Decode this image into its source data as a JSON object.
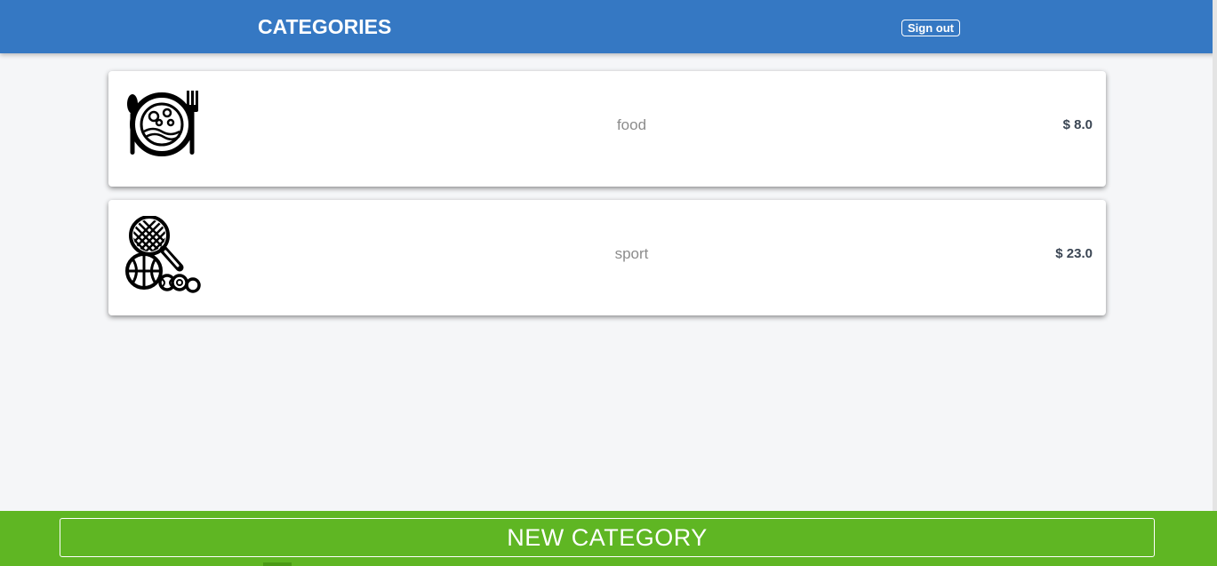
{
  "header": {
    "title": "CATEGORIES",
    "signout_label": "Sign out"
  },
  "categories": [
    {
      "name": "food",
      "amount": "$ 8.0",
      "icon": "food-plate-icon"
    },
    {
      "name": "sport",
      "amount": "$ 23.0",
      "icon": "sport-equipment-icon"
    }
  ],
  "footer": {
    "new_category_label": "NEW CATEGORY"
  },
  "colors": {
    "header": "#3578c3",
    "footer": "#5fb623",
    "background": "#f5f6f8"
  }
}
